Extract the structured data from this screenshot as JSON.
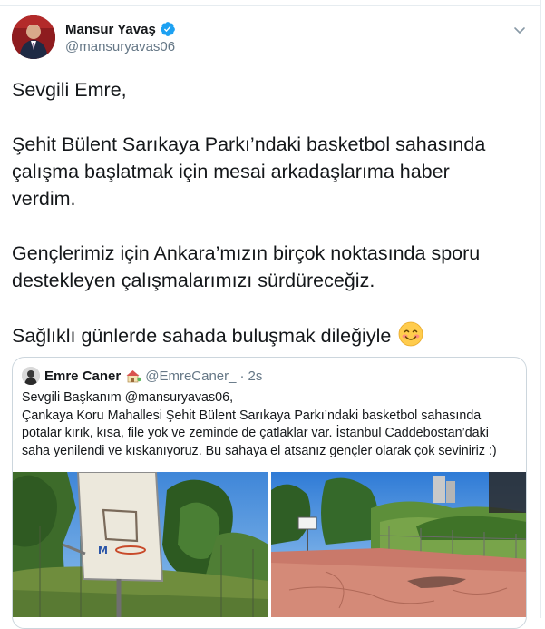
{
  "author": {
    "name": "Mansur Yavaş",
    "handle": "@mansuryavas06",
    "verified_icon": "verified-badge-icon",
    "menu_icon": "chevron-down-icon"
  },
  "tweet": {
    "lines": [
      "Sevgili Emre,",
      "Şehit Bülent Sarıkaya Parkı’ndaki basketbol sahasında",
      "çalışma başlatmak için mesai arkadaşlarıma haber",
      "verdim.",
      "Gençlerimiz için Ankara’mızın birçok noktasında sporu",
      "destekleyen çalışmalarımızı sürdüreceğiz.",
      "Sağlıklı günlerde sahada buluşmak dileğiyle"
    ],
    "emoji": "smiling-face-emoji"
  },
  "quote": {
    "name": "Emre Caner",
    "name_emoji": "house-with-garden-emoji",
    "handle": "@EmreCaner_",
    "separator": "·",
    "time": "2s",
    "lines": [
      "Sevgili Başkanım @mansuryavas06,",
      "Çankaya Koru Mahallesi Şehit Bülent Sarıkaya Parkı’ndaki basketbol sahasında",
      "potalar kırık, kısa, file yok ve zeminde de çatlaklar var. İstanbul Caddebostan’daki",
      "saha yenilendi ve kıskanıyoruz. Bu sahaya el atsanız gençler olarak çok seviniriz :)"
    ],
    "photos": [
      "broken-basketball-hoop-photo",
      "cracked-basketball-court-photo"
    ]
  },
  "colors": {
    "text": "#14171a",
    "secondary": "#657786",
    "verified": "#1da1f2",
    "border": "#ccd6dd"
  }
}
